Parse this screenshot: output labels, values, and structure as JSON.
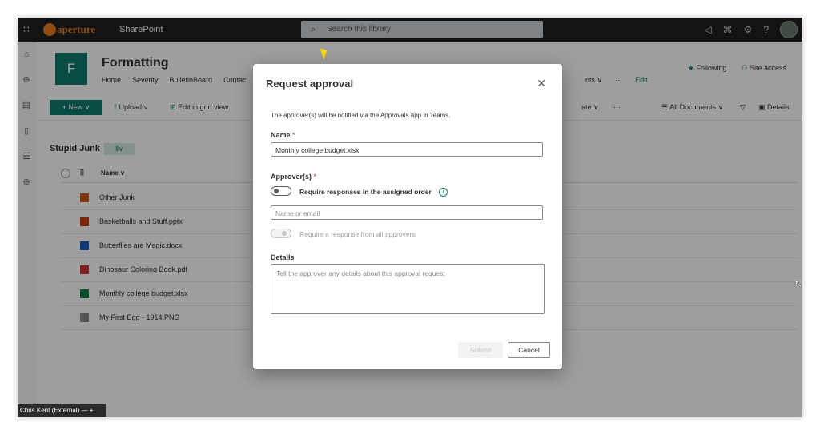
{
  "topbar": {
    "logo_text": "aperture",
    "app_name": "SharePoint",
    "search_placeholder": "Search this library",
    "icons": [
      "megaphone-icon",
      "share-icon",
      "gear-icon",
      "help-icon"
    ]
  },
  "site": {
    "icon_letter": "F",
    "title": "Formatting",
    "nav": [
      "Home",
      "Severity",
      "BulletinBoard",
      "Contac"
    ],
    "nav_tail": [
      "nts ∨",
      "···",
      "Edit"
    ],
    "following": "Following",
    "site_access": "Site access"
  },
  "commandbar": {
    "new": "+ New ∨",
    "upload": "Upload ∨",
    "edit_grid": "Edit in grid view",
    "automate": "ate ∨",
    "more": "···",
    "all_documents": "All Documents ∨",
    "details": "Details"
  },
  "library": {
    "title": "Stupid Junk",
    "name_header": "Name ∨",
    "files": [
      {
        "name": "Other Junk",
        "color": "#c55a11"
      },
      {
        "name": "Basketballs and Stuff.pptx",
        "color": "#c43e1c"
      },
      {
        "name": "Butterflies are Magic.docx",
        "color": "#185abd"
      },
      {
        "name": "Dinosaur Coloring Book.pdf",
        "color": "#d13438"
      },
      {
        "name": "Monthly college budget.xlsx",
        "color": "#107c41"
      },
      {
        "name": "My First Egg - 1914.PNG",
        "color": "#8a8886"
      }
    ]
  },
  "dialog": {
    "title": "Request approval",
    "info": "The approver(s) will be notified via the Approvals app in Teams.",
    "name_label": "Name",
    "name_value": "Monthly college budget.xlsx",
    "approvers_label": "Approver(s)",
    "required_mark": "*",
    "assigned_order_label": "Require responses in the assigned order",
    "approver_placeholder": "Name or email",
    "all_approvers_label": "Require a response from all approvers",
    "details_label": "Details",
    "details_placeholder": "Tell the approver any details about this approval request",
    "submit": "Submit",
    "cancel": "Cancel"
  },
  "status": {
    "user": "Chris Kent (External)",
    "controls": "—  +"
  }
}
